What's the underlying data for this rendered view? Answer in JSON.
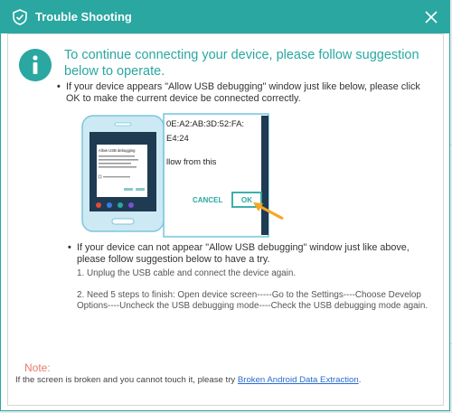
{
  "window": {
    "title": "Trouble Shooting",
    "accent_color": "#2aa7a1",
    "icons": {
      "title": "shield-check-icon",
      "close": "close-icon",
      "info": "info-icon"
    }
  },
  "header": {
    "text": "To continue connecting your device, please follow suggestion below to operate."
  },
  "bullet1": {
    "text": "If your device appears \"Allow USB debugging\" window just like below, please click OK to make the current device  be connected correctly."
  },
  "illustration": {
    "phone_dialog_title": "Allow USB debugging",
    "fingerprint_line1": "0E:A2:AB:3D:52:FA:",
    "fingerprint_line2": "E4:24",
    "allow_text": "llow from this",
    "cancel_label": "CANCEL",
    "ok_label": "OK"
  },
  "bullet2": {
    "text": "If your device can not appear \"Allow USB debugging\" window just like above, please follow suggestion below to have a try."
  },
  "steps": {
    "step1": "1. Unplug the USB cable and connect the device again.",
    "step2": "2. Need 5 steps to finish: Open device screen-----Go to the Settings----Choose Develop Options----Uncheck the USB debugging mode----Check the USB debugging mode again."
  },
  "note": {
    "label": "Note:",
    "text": "If the screen is broken and you cannot touch it, please try ",
    "link": "Broken Android Data Extraction",
    "suffix": ".",
    "label_color": "#e8796a",
    "link_color": "#2a6cd1"
  }
}
